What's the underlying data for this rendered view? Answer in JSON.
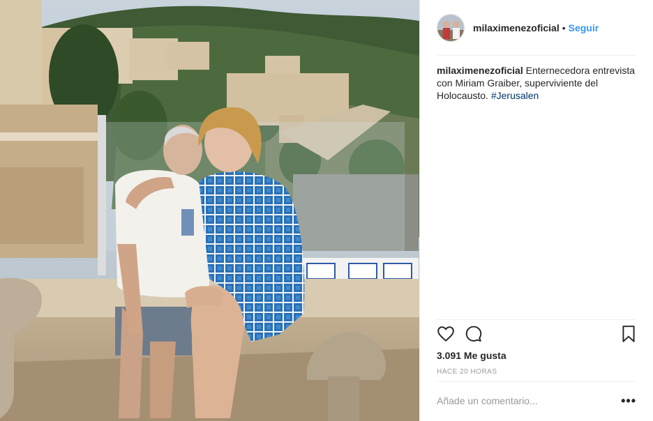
{
  "post": {
    "username": "milaximenezoficial",
    "separator": "•",
    "follow_label": "Seguir",
    "caption_text": "Enternecedora entrevista con Miriam Graiber, superviviente del Holocausto.",
    "hashtag": "#Jerusalen",
    "likes_text": "3.091 Me gusta",
    "time_text": "HACE 20 HORAS",
    "comment_placeholder": "Añade un comentario...",
    "more_label": "•••"
  },
  "icons": {
    "like": "heart-icon",
    "comment": "comment-icon",
    "save": "bookmark-icon",
    "more": "more-options-icon"
  },
  "colors": {
    "link_blue": "#3897f0",
    "hashtag_blue": "#003569",
    "text": "#262626",
    "muted": "#999999",
    "border": "#efefef"
  }
}
